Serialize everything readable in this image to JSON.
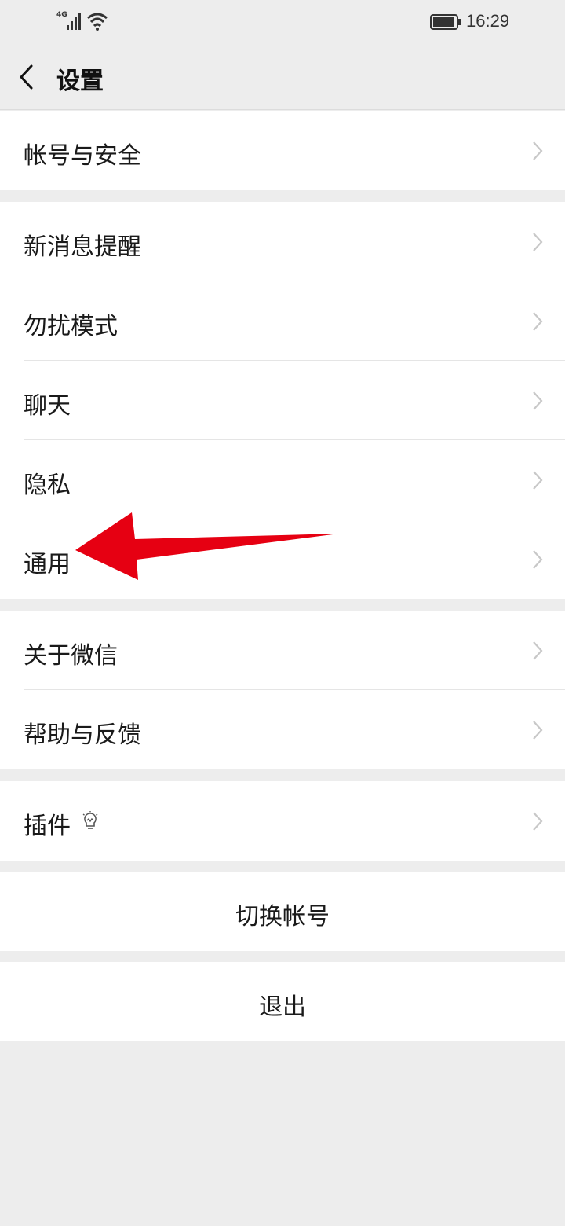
{
  "status_bar": {
    "network": "4G",
    "time": "16:29"
  },
  "header": {
    "title": "设置"
  },
  "groups": {
    "account": {
      "items": [
        {
          "label": "帐号与安全"
        }
      ]
    },
    "settings": {
      "items": [
        {
          "label": "新消息提醒"
        },
        {
          "label": "勿扰模式"
        },
        {
          "label": "聊天"
        },
        {
          "label": "隐私"
        },
        {
          "label": "通用"
        }
      ]
    },
    "about": {
      "items": [
        {
          "label": "关于微信"
        },
        {
          "label": "帮助与反馈"
        }
      ]
    },
    "plugins": {
      "items": [
        {
          "label": "插件"
        }
      ]
    }
  },
  "actions": {
    "switch_account": "切换帐号",
    "logout": "退出"
  },
  "colors": {
    "background": "#ededed",
    "card": "#ffffff",
    "annotation_arrow": "#e60012"
  }
}
